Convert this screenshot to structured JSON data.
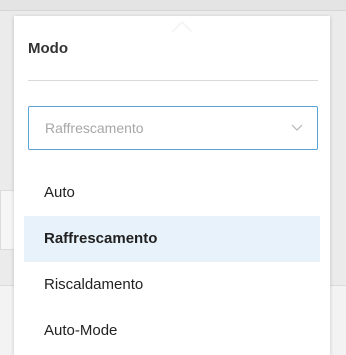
{
  "modal": {
    "title": "Modo",
    "select": {
      "value": "Raffrescamento",
      "chevron_icon": "chevron-down-icon"
    },
    "options": [
      {
        "label": "Auto",
        "selected": false
      },
      {
        "label": "Raffrescamento",
        "selected": true
      },
      {
        "label": "Riscaldamento",
        "selected": false
      },
      {
        "label": "Auto-Mode",
        "selected": false
      }
    ]
  },
  "colors": {
    "select_border": "#5aa4d6",
    "selected_row_bg": "#e7f2fa",
    "primary_button": "#1b5f78"
  }
}
